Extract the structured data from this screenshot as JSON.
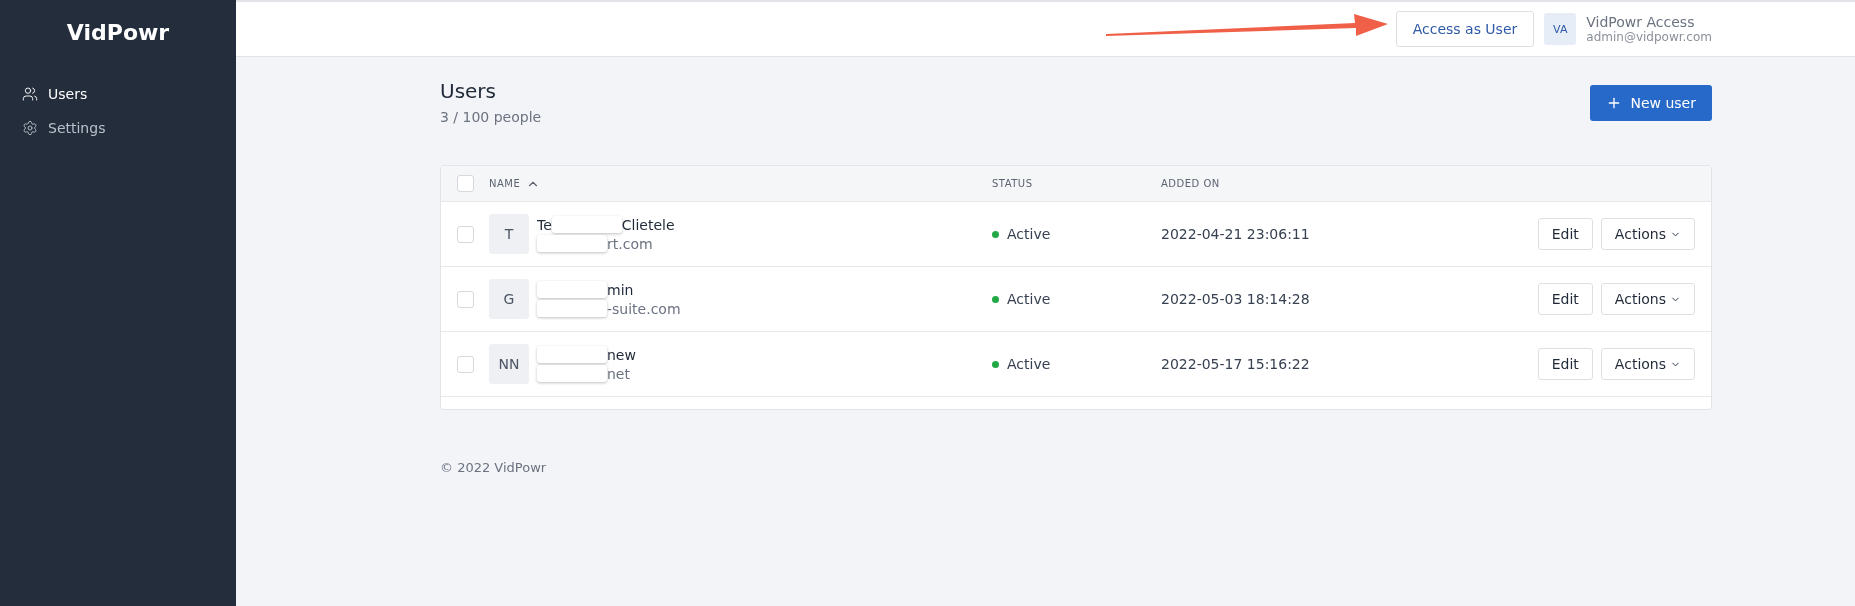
{
  "sidebar": {
    "brand": "VidPowr",
    "items": [
      {
        "label": "Users",
        "kind": "users",
        "selected": true
      },
      {
        "label": "Settings",
        "kind": "settings",
        "selected": false
      }
    ]
  },
  "header": {
    "access_button": "Access as User",
    "account": {
      "initials": "VA",
      "name": "VidPowr Access",
      "email": "admin@vidpowr.com"
    },
    "annotation_arrow": true
  },
  "page": {
    "title": "Users",
    "subtitle": "3 / 100 people",
    "new_button": "New user"
  },
  "table": {
    "select_all_checked": false,
    "columns": [
      {
        "label": "NAME",
        "sorted": true
      },
      {
        "label": "STATUS",
        "sorted": false
      },
      {
        "label": "ADDED ON",
        "sorted": false
      }
    ],
    "rows": [
      {
        "checked": false,
        "avatar": "T",
        "name": [
          {
            "kind": "text",
            "text": "Te"
          },
          {
            "kind": "redacted"
          },
          {
            "kind": "text",
            "text": "Clietele"
          }
        ],
        "email": [
          {
            "kind": "redacted"
          },
          {
            "kind": "text",
            "text": "rt.com"
          }
        ],
        "status": "Active",
        "color": "#22a845",
        "added": "2022-04-21 23:06:11",
        "edit": "Edit",
        "actions": "Actions"
      },
      {
        "checked": false,
        "avatar": "G",
        "name": [
          {
            "kind": "redacted"
          },
          {
            "kind": "text",
            "text": "min"
          }
        ],
        "email": [
          {
            "kind": "redacted"
          },
          {
            "kind": "text",
            "text": "-suite.com"
          }
        ],
        "status": "Active",
        "color": "#22a845",
        "added": "2022-05-03 18:14:28",
        "edit": "Edit",
        "actions": "Actions"
      },
      {
        "checked": false,
        "avatar": "NN",
        "name": [
          {
            "kind": "redacted"
          },
          {
            "kind": "text",
            "text": "new"
          }
        ],
        "email": [
          {
            "kind": "redacted"
          },
          {
            "kind": "text",
            "text": "net"
          }
        ],
        "status": "Active",
        "color": "#22a845",
        "added": "2022-05-17 15:16:22",
        "edit": "Edit",
        "actions": "Actions"
      }
    ]
  },
  "footer": "© 2022 VidPowr"
}
